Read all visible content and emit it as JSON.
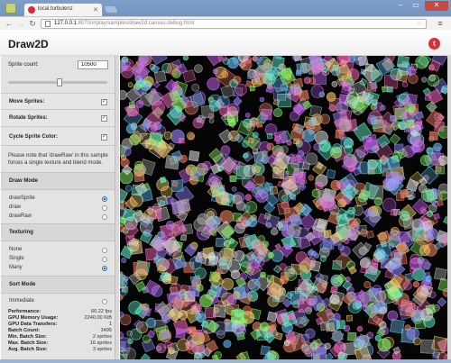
{
  "browser": {
    "tab_title": "local.turbulenz",
    "tab_close": "✕",
    "url_host": "127.0.0.1",
    "url_path": ":8070/#/play/samples/draw2d.canvas.debug.html",
    "nav_back": "←",
    "nav_forward": "→",
    "nav_reload": "↻",
    "menu": "≡",
    "star": "☆",
    "window_minimize": "–",
    "window_maximize": "▭",
    "window_close": "✕"
  },
  "app": {
    "title": "Draw2D",
    "logo_glyph": "t"
  },
  "sidebar": {
    "sprite_count_label": "Sprite count:",
    "sprite_count_value": "10500",
    "slider_level": 0.52,
    "move_sprites_label": "Move Sprites:",
    "move_sprites_checked": true,
    "rotate_sprites_label": "Rotate Sprites:",
    "rotate_sprites_checked": true,
    "cycle_color_label": "Cycle Sprite Color:",
    "cycle_color_checked": true,
    "check_glyph": "✓",
    "note": "Please note that 'drawRaw' in this sample forces a single texture and blend mode.",
    "draw_mode": {
      "header": "Draw Mode",
      "options": [
        "drawSprite",
        "draw",
        "drawRaw"
      ],
      "selected": 0
    },
    "texturing": {
      "header": "Texturing",
      "options": [
        "None",
        "Single",
        "Many"
      ],
      "selected": 2
    },
    "sort_mode": {
      "header": "Sort Mode",
      "options": [
        "Immediate"
      ],
      "selected": -1
    },
    "stats": [
      {
        "label": "Performance:",
        "value": "60.22 fps"
      },
      {
        "label": "GPU Memory Usage:",
        "value": "2240.00 KiB"
      },
      {
        "label": "GPU Data Transfers:",
        "value": "1"
      },
      {
        "label": "Batch Count:",
        "value": "3495"
      },
      {
        "label": "Min. Batch Size:",
        "value": "2 sprites"
      },
      {
        "label": "Max. Batch Size:",
        "value": "16 sprites"
      },
      {
        "label": "Avg. Batch Size:",
        "value": "3 sprites"
      }
    ]
  },
  "canvas": {
    "background": "#050505",
    "sprite_palette": [
      "#e0e0e0",
      "#8cff6a",
      "#d46cff",
      "#6cc8ff",
      "#ff6cc4",
      "#ffd46c",
      "#6cffd8",
      "#b0b0b0",
      "#ff8a6a",
      "#9a8cff"
    ]
  }
}
